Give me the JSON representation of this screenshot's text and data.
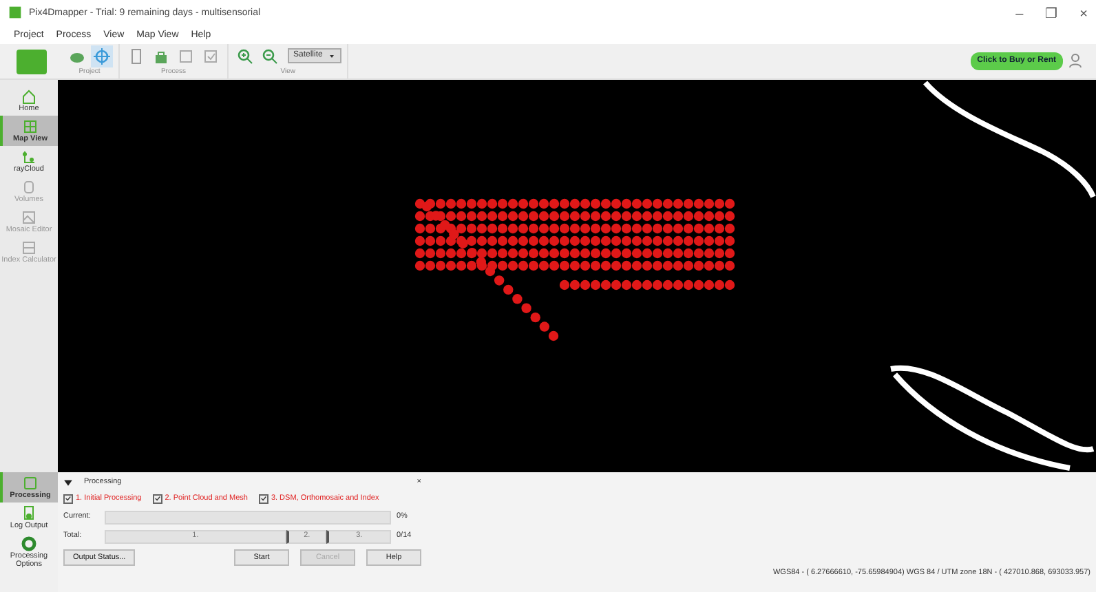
{
  "window": {
    "title": "Pix4Dmapper - Trial: 9 remaining days - multisensorial",
    "controls": [
      "–",
      "❐",
      "×"
    ]
  },
  "menu": [
    "Project",
    "Process",
    "View",
    "Map View",
    "Help"
  ],
  "toolbar": {
    "groups": [
      {
        "label": "Project",
        "icons": [
          {
            "kind": "cloud",
            "selected": false
          },
          {
            "kind": "target",
            "selected": true
          }
        ]
      },
      {
        "label": "Process",
        "icons": [
          {
            "kind": "page",
            "selected": false
          },
          {
            "kind": "bag",
            "selected": false
          },
          {
            "kind": "square",
            "selected": false
          },
          {
            "kind": "check",
            "selected": false
          }
        ]
      },
      {
        "label": "View",
        "icons": [
          {
            "kind": "zoomin",
            "selected": false
          },
          {
            "kind": "zoomout",
            "selected": false
          }
        ]
      }
    ],
    "basemap": "Satellite",
    "buy_button": "Click to Buy or Rent"
  },
  "sidebar": {
    "items": [
      {
        "label": "Home",
        "selected": false,
        "disabled": false
      },
      {
        "label": "Map View",
        "selected": true,
        "disabled": false
      },
      {
        "label": "rayCloud",
        "selected": false,
        "disabled": false
      },
      {
        "label": "Volumes",
        "selected": false,
        "disabled": true
      },
      {
        "label": "Mosaic Editor",
        "selected": false,
        "disabled": true
      },
      {
        "label": "Index Calculator",
        "selected": false,
        "disabled": true
      }
    ],
    "bottom_items": [
      {
        "label": "Processing",
        "selected": true
      },
      {
        "label": "Log Output",
        "selected": false
      },
      {
        "label": "Processing Options",
        "selected": false
      }
    ]
  },
  "processing": {
    "title": "Processing",
    "close": "×",
    "steps": [
      {
        "label": "1. Initial Processing",
        "checked": true
      },
      {
        "label": "2. Point Cloud and Mesh",
        "checked": true
      },
      {
        "label": "3. DSM, Orthomosaic and Index",
        "checked": true
      }
    ],
    "current": {
      "label": "Current:",
      "level": 0,
      "reading": "0%"
    },
    "total": {
      "label": "Total:",
      "segments": [
        "1.",
        "2.",
        "3."
      ],
      "reading": "0/14"
    },
    "buttons": [
      {
        "label": "Output Status...",
        "disabled": false
      },
      {
        "label": "Start",
        "disabled": false
      },
      {
        "label": "Cancel",
        "disabled": true
      },
      {
        "label": "Help",
        "disabled": false
      }
    ]
  },
  "status_bar": "WGS84 - ( 6.27666610, -75.65984904) WGS 84 / UTM zone 18N - ( 427010.868, 693033.957)"
}
